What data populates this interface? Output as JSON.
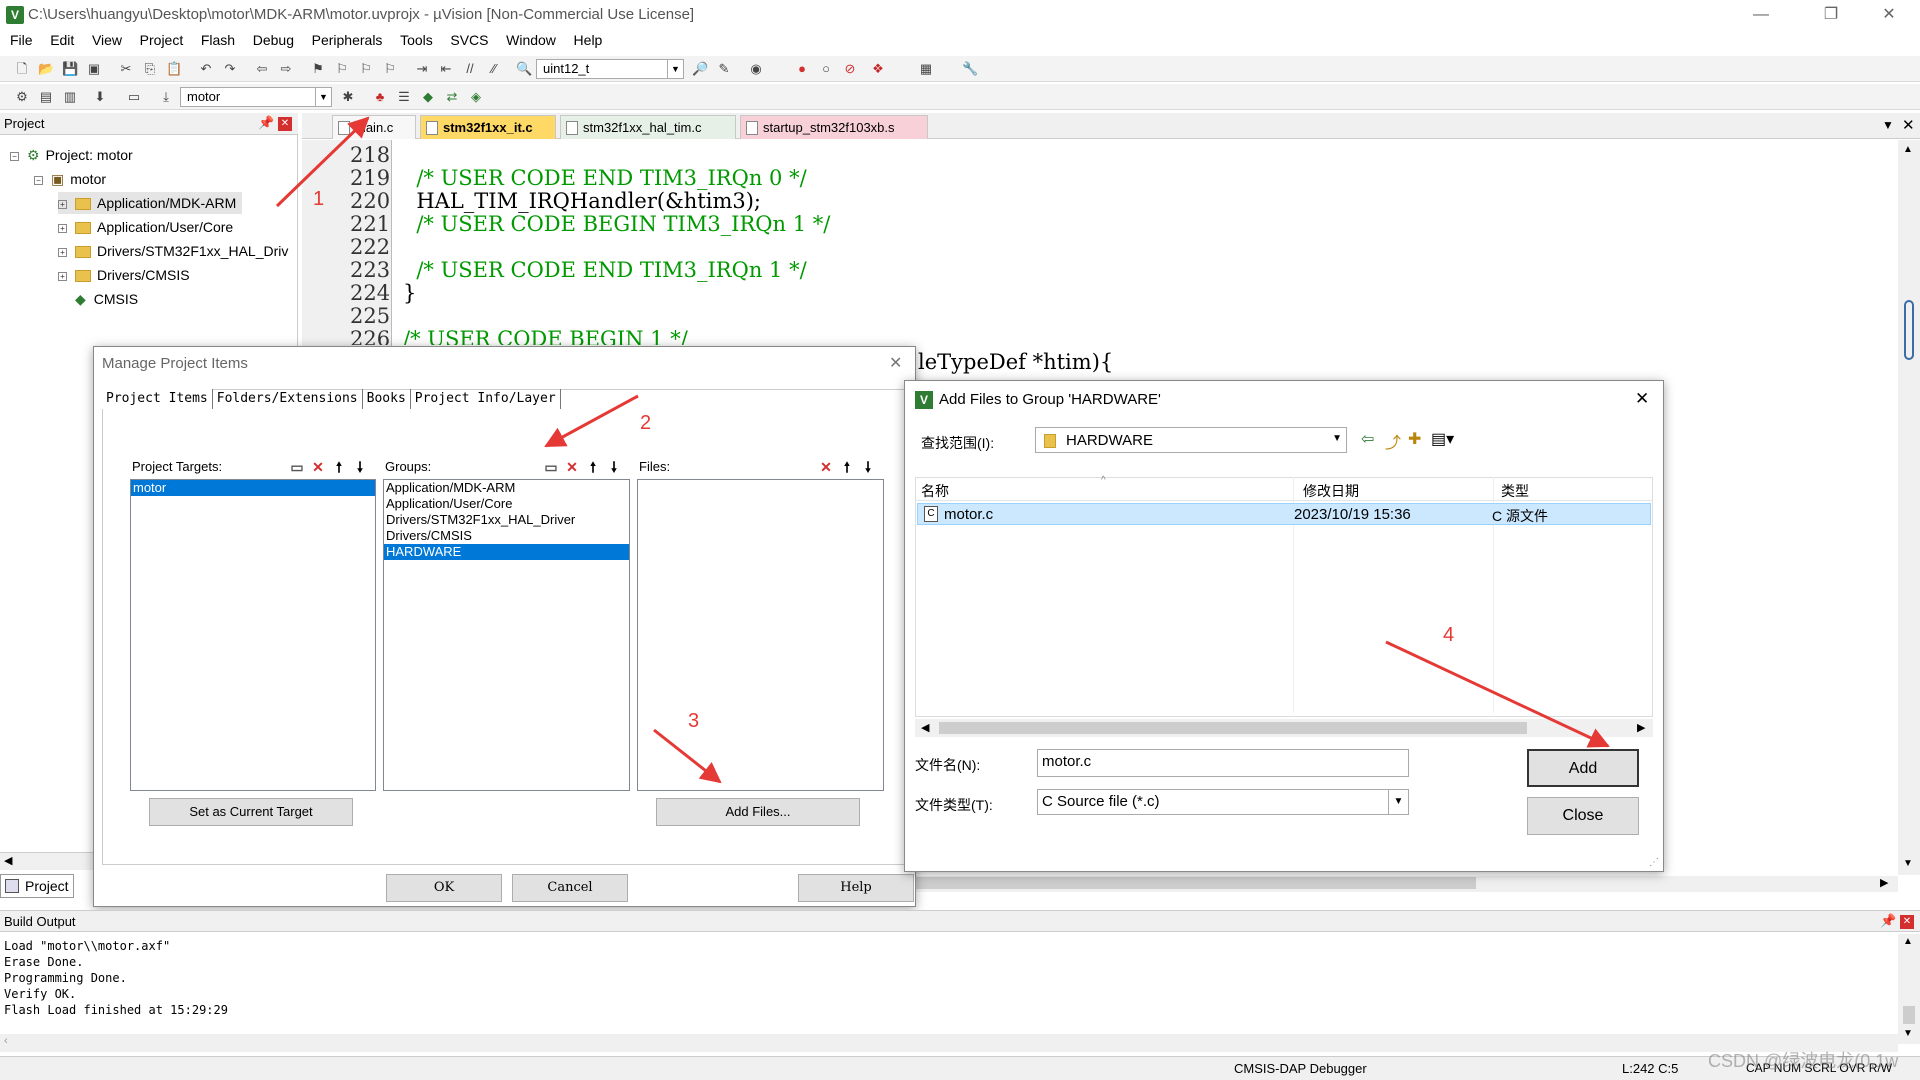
{
  "window": {
    "title": "C:\\Users\\huangyu\\Desktop\\motor\\MDK-ARM\\motor.uvprojx - µVision  [Non-Commercial Use License]",
    "logo": "V"
  },
  "menu": [
    "File",
    "Edit",
    "View",
    "Project",
    "Flash",
    "Debug",
    "Peripherals",
    "Tools",
    "SVCS",
    "Window",
    "Help"
  ],
  "toolbar": {
    "find_combo": "uint12_t",
    "target_combo": "motor"
  },
  "project_panel": {
    "header": "Project",
    "root": "Project: motor",
    "target": "motor",
    "groups": [
      "Application/MDK-ARM",
      "Application/User/Core",
      "Drivers/STM32F1xx_HAL_Driv",
      "Drivers/CMSIS",
      "CMSIS"
    ],
    "bottom_tab": "Project"
  },
  "editor": {
    "tabs": [
      "main.c",
      "stm32f1xx_it.c",
      "stm32f1xx_hal_tim.c",
      "startup_stm32f103xb.s"
    ],
    "active_tab": "stm32f1xx_it.c",
    "lines": [
      {
        "num": "218",
        "text": ""
      },
      {
        "num": "219",
        "text": "  /* USER CODE END TIM3_IRQn 0 */",
        "comment": true
      },
      {
        "num": "220",
        "text": "  HAL_TIM_IRQHandler(&htim3);",
        "comment": false
      },
      {
        "num": "221",
        "text": "  /* USER CODE BEGIN TIM3_IRQn 1 */",
        "comment": true
      },
      {
        "num": "222",
        "text": ""
      },
      {
        "num": "223",
        "text": "  /* USER CODE END TIM3_IRQn 1 */",
        "comment": true
      },
      {
        "num": "224",
        "text": "}",
        "comment": false
      },
      {
        "num": "225",
        "text": ""
      },
      {
        "num": "226",
        "text": "/* USER CODE BEGIN 1 */",
        "comment": true
      }
    ],
    "partial_line": "leTypeDef *htim){"
  },
  "manage_dialog": {
    "title": "Manage Project Items",
    "tabs": [
      "Project Items",
      "Folders/Extensions",
      "Books",
      "Project Info/Layer"
    ],
    "targets_label": "Project Targets:",
    "targets": [
      "motor"
    ],
    "groups_label": "Groups:",
    "groups": [
      "Application/MDK-ARM",
      "Application/User/Core",
      "Drivers/STM32F1xx_HAL_Driver",
      "Drivers/CMSIS",
      "HARDWARE"
    ],
    "selected_group": "HARDWARE",
    "files_label": "Files:",
    "set_target_button": "Set as Current Target",
    "add_files_button": "Add Files...",
    "ok": "OK",
    "cancel": "Cancel",
    "help": "Help"
  },
  "add_files_dialog": {
    "title": "Add Files to Group 'HARDWARE'",
    "look_in_label": "查找范围(I):",
    "look_in_value": "HARDWARE",
    "col_name": "名称",
    "col_date": "修改日期",
    "col_type": "类型",
    "files": [
      {
        "name": "motor.c",
        "date": "2023/10/19 15:36",
        "type": "C 源文件"
      }
    ],
    "filename_label": "文件名(N):",
    "filename_value": "motor.c",
    "filetype_label": "文件类型(T):",
    "filetype_value": "C Source file (*.c)",
    "add_button": "Add",
    "close_button": "Close"
  },
  "build_output": {
    "header": "Build Output",
    "lines": [
      "Load \"motor\\\\motor.axf\"",
      "Erase Done.",
      "Programming Done.",
      "Verify OK.",
      "Flash Load finished at 15:29:29"
    ]
  },
  "status": {
    "debugger": "CMSIS-DAP Debugger",
    "position": "L:242 C:5",
    "flags": "CAP  NUM  SCRL  OVR  R/W"
  },
  "watermark": "CSDN @绿波电龙(0.1w",
  "annotations": [
    "1",
    "2",
    "3",
    "4"
  ],
  "colors": {
    "selection": "#0078d7",
    "comment": "#009900",
    "arrow": "#e53935",
    "active_tab": "#ffd966"
  }
}
